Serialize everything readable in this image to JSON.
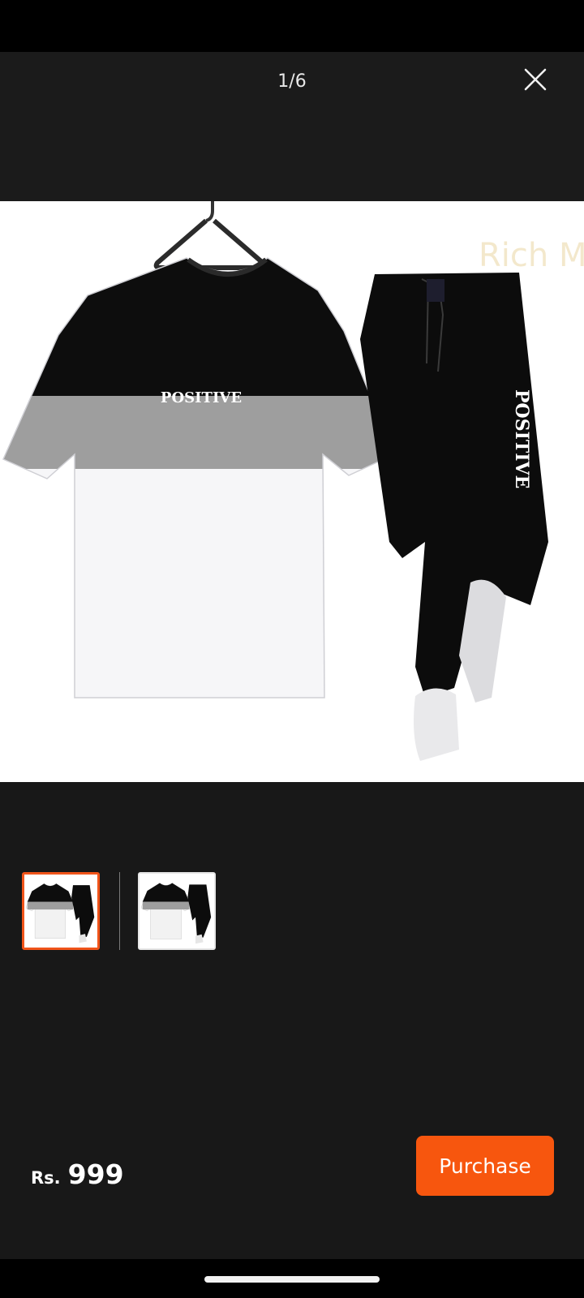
{
  "viewer": {
    "counter": "1/6",
    "close_icon": "close-icon"
  },
  "product": {
    "tshirt_print": "POSITIVE",
    "pants_print": "POSITIVE",
    "watermark": "Rich MAN"
  },
  "thumbnails": [
    {
      "name": "thumbnail-1",
      "selected": true
    },
    {
      "name": "thumbnail-2",
      "selected": false
    }
  ],
  "footer": {
    "currency": "Rs.",
    "price": "999",
    "purchase_label": "Purchase"
  },
  "colors": {
    "accent": "#f7560e",
    "background": "#181818",
    "header": "#1b1b1b"
  }
}
